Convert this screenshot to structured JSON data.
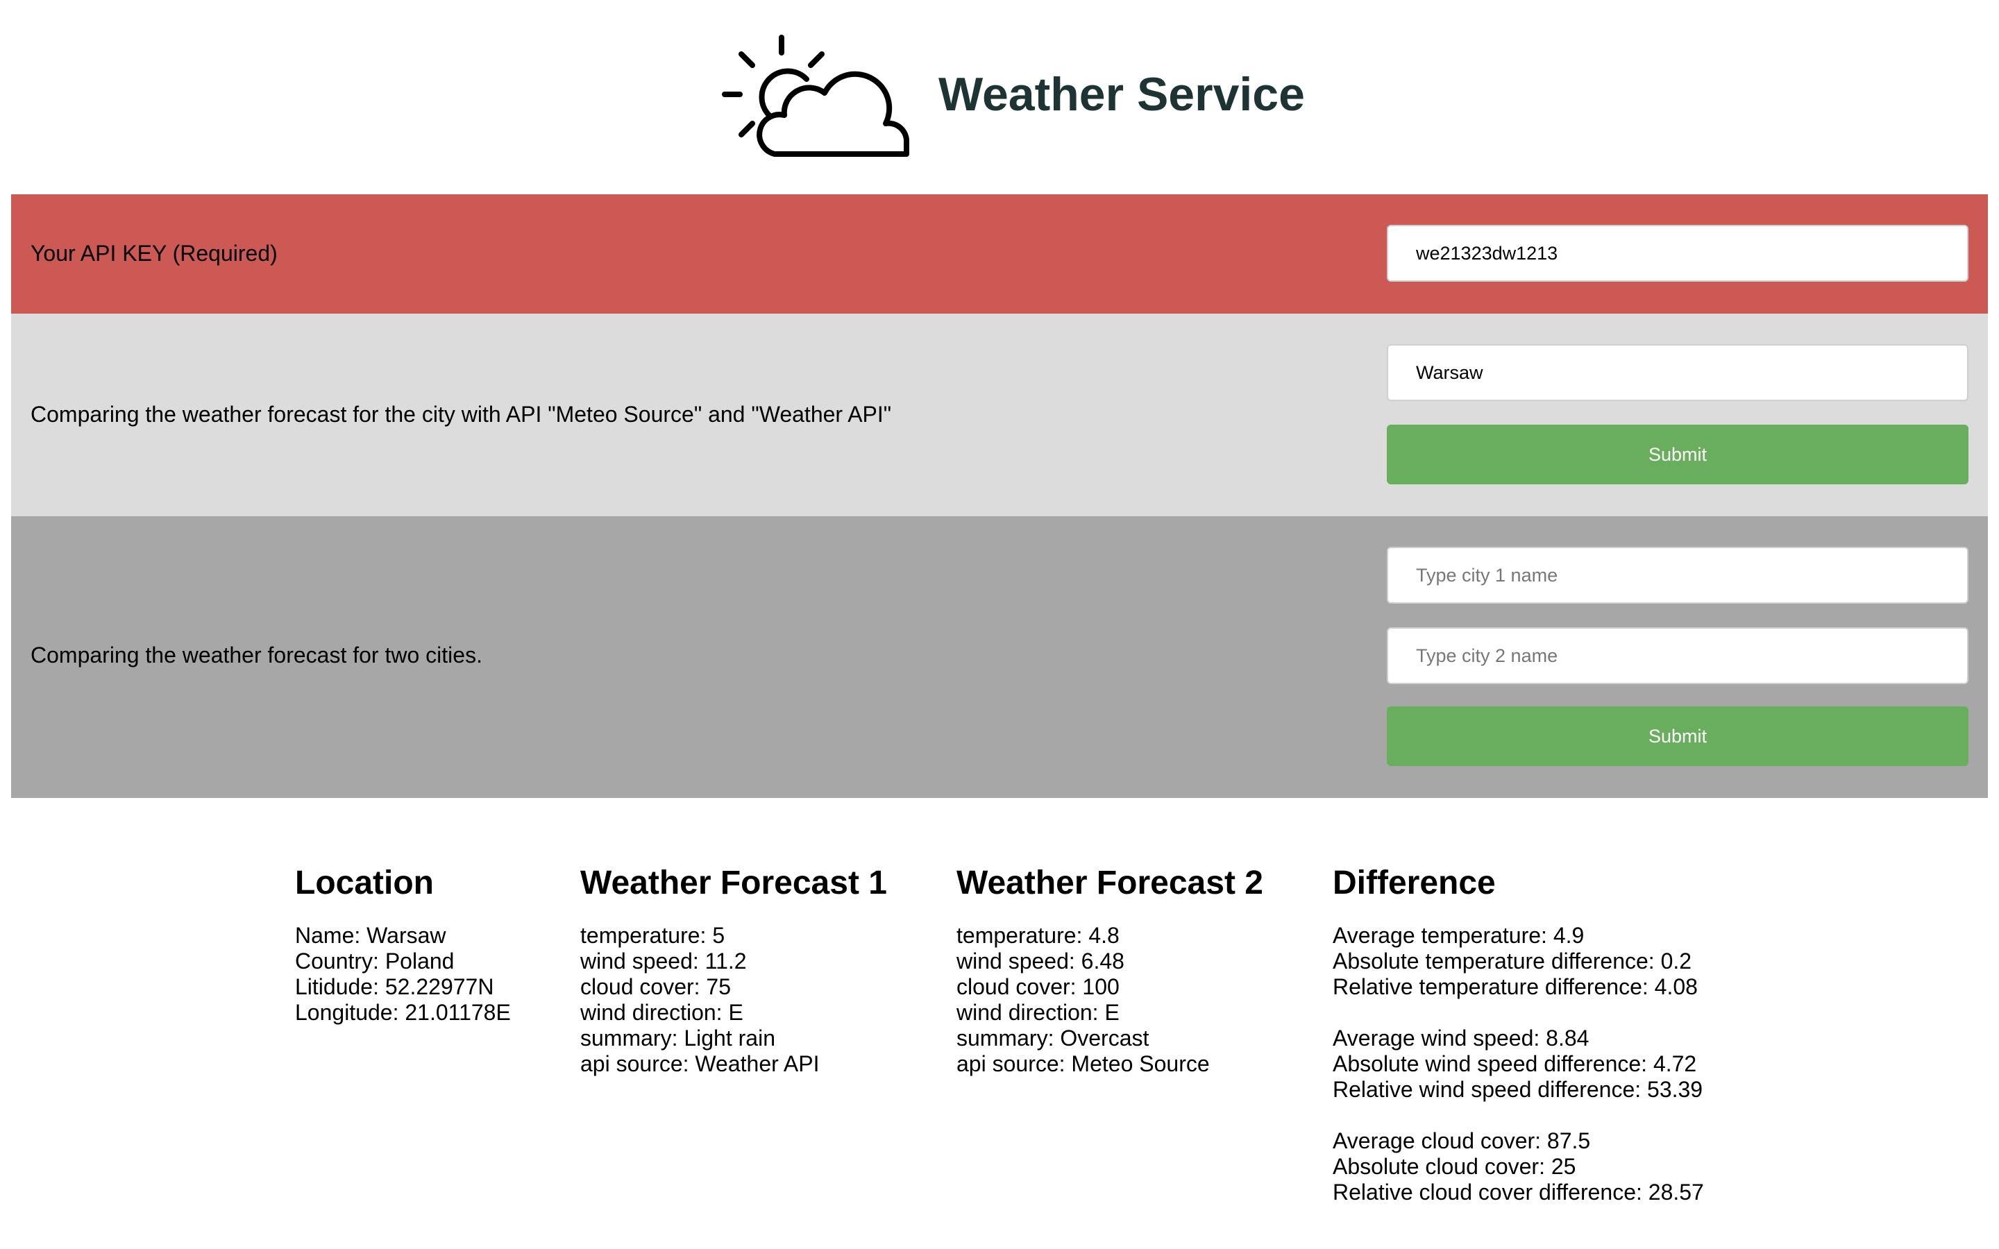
{
  "colors": {
    "api_section_bg": "#cd5955",
    "single_section_bg": "#dcdcdc",
    "double_section_bg": "#a7a7a7",
    "button_bg": "#69ae5c",
    "title_color": "#1d3334"
  },
  "header": {
    "logo_icon": "sun-behind-cloud-icon",
    "title": "Weather Service"
  },
  "api_section": {
    "label": "Your API KEY (Required)",
    "api_key_value": "we21323dw1213"
  },
  "single_city_section": {
    "label": "Comparing the weather forecast for the city with API \"Meteo Source\" and \"Weather API\"",
    "city_value": "Warsaw",
    "submit_label": "Submit"
  },
  "two_cities_section": {
    "label": "Comparing the weather forecast for two cities.",
    "city1_placeholder": "Type city 1 name",
    "city2_placeholder": "Type city 2 name",
    "submit_label": "Submit"
  },
  "results": {
    "location": {
      "heading": "Location",
      "name": "Name: Warsaw",
      "country": "Country: Poland",
      "latitude": "Litidude: 52.22977N",
      "longitude": "Longitude: 21.01178E"
    },
    "forecast1": {
      "heading": "Weather Forecast 1",
      "temperature": "temperature: 5",
      "wind_speed": "wind speed: 11.2",
      "cloud_cover": "cloud cover: 75",
      "wind_direction": "wind direction: E",
      "summary": "summary: Light rain",
      "api_source": "api source: Weather API"
    },
    "forecast2": {
      "heading": "Weather Forecast 2",
      "temperature": "temperature: 4.8",
      "wind_speed": "wind speed: 6.48",
      "cloud_cover": "cloud cover: 100",
      "wind_direction": "wind direction: E",
      "summary": "summary: Overcast",
      "api_source": "api source: Meteo Source"
    },
    "difference": {
      "heading": "Difference",
      "avg_temperature": "Average temperature: 4.9",
      "abs_temperature": "Absolute temperature difference: 0.2",
      "rel_temperature": "Relative temperature difference: 4.08",
      "avg_wind": "Average wind speed: 8.84",
      "abs_wind": "Absolute wind speed difference: 4.72",
      "rel_wind": "Relative wind speed difference: 53.39",
      "avg_cloud": "Average cloud cover: 87.5",
      "abs_cloud": "Absolute cloud cover: 25",
      "rel_cloud": "Relative cloud cover difference: 28.57"
    }
  }
}
